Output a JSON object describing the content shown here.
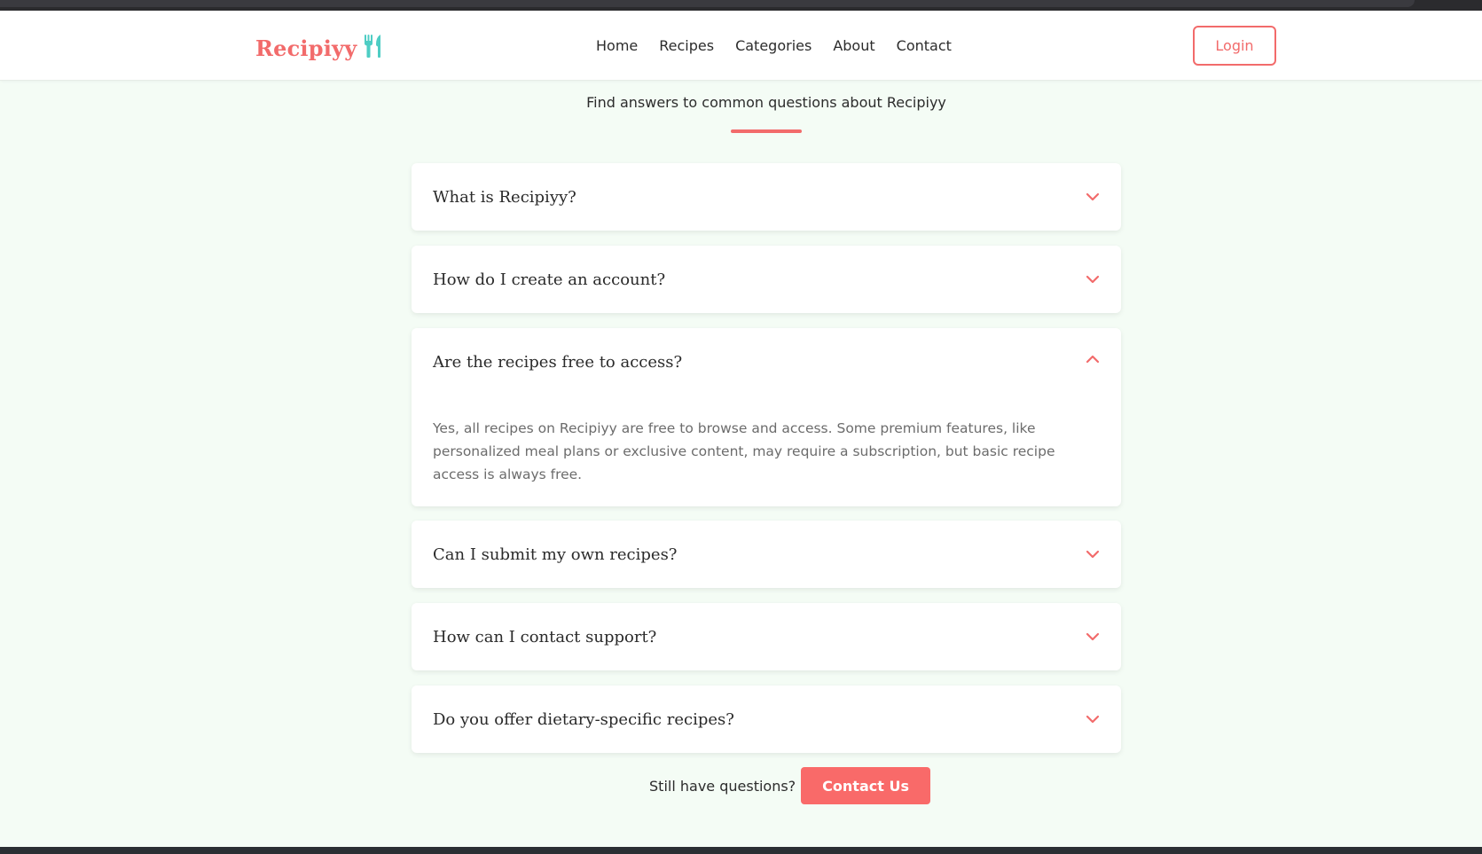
{
  "brand": {
    "name": "Recipiyy",
    "icon": "utensils-icon",
    "accent": "#f26b6b",
    "icon_color": "#4ecdc4"
  },
  "nav": {
    "items": [
      "Home",
      "Recipes",
      "Categories",
      "About",
      "Contact"
    ]
  },
  "header": {
    "login_label": "Login"
  },
  "faq": {
    "subtitle": "Find answers to common questions about Recipiyy",
    "items": [
      {
        "question": "What is Recipiyy?",
        "expanded": false
      },
      {
        "question": "How do I create an account?",
        "expanded": false
      },
      {
        "question": "Are the recipes free to access?",
        "expanded": true,
        "answer": "Yes, all recipes on Recipiyy are free to browse and access. Some premium features, like personalized meal plans or exclusive content, may require a subscription, but basic recipe access is always free."
      },
      {
        "question": "Can I submit my own recipes?",
        "expanded": false
      },
      {
        "question": "How can I contact support?",
        "expanded": false
      },
      {
        "question": "Do you offer dietary-specific recipes?",
        "expanded": false
      }
    ]
  },
  "contact": {
    "prompt": "Still have questions?",
    "button_label": "Contact Us"
  }
}
